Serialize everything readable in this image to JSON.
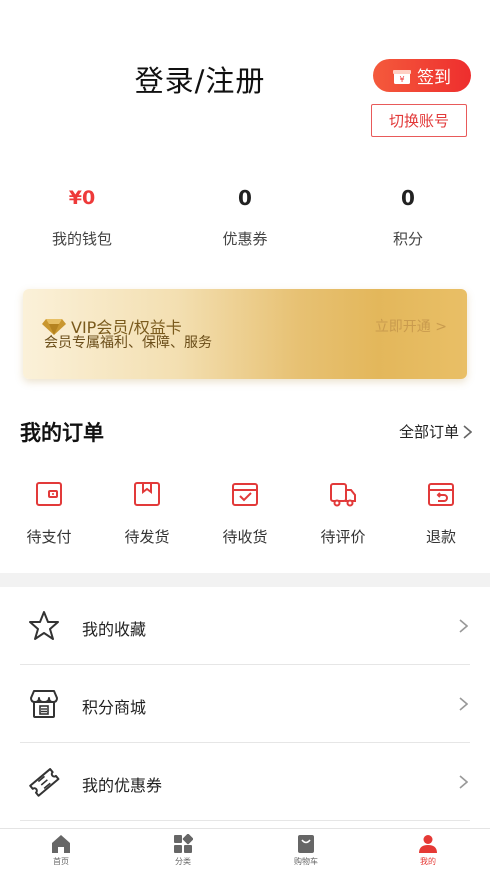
{
  "header": {
    "title": "登录/注册",
    "signin_label": "签到",
    "switch_label": "切换账号"
  },
  "stats": [
    {
      "value": "¥0",
      "label": "我的钱包"
    },
    {
      "value": "0",
      "label": "优惠券"
    },
    {
      "value": "0",
      "label": "积分"
    }
  ],
  "vip": {
    "title": "VIP会员/权益卡",
    "subtitle": "会员专属福利、保障、服务",
    "action": "立即开通 >"
  },
  "orders": {
    "title": "我的订单",
    "all_label": "全部订单",
    "items": [
      {
        "label": "待支付",
        "icon": "wallet-icon"
      },
      {
        "label": "待发货",
        "icon": "package-icon"
      },
      {
        "label": "待收货",
        "icon": "receive-box-icon"
      },
      {
        "label": "待评价",
        "icon": "truck-icon"
      },
      {
        "label": "退款",
        "icon": "refund-icon"
      }
    ]
  },
  "menu": [
    {
      "label": "我的收藏",
      "icon": "star-icon"
    },
    {
      "label": "积分商城",
      "icon": "store-icon"
    },
    {
      "label": "我的优惠券",
      "icon": "ticket-icon"
    }
  ],
  "tabbar": [
    {
      "label": "首页",
      "icon": "home-icon"
    },
    {
      "label": "分类",
      "icon": "category-icon"
    },
    {
      "label": "购物车",
      "icon": "cart-bag-icon"
    },
    {
      "label": "我的",
      "icon": "profile-icon",
      "active": true
    }
  ],
  "colors": {
    "accent": "#ee3a3a",
    "gold": "#e3b75b"
  }
}
